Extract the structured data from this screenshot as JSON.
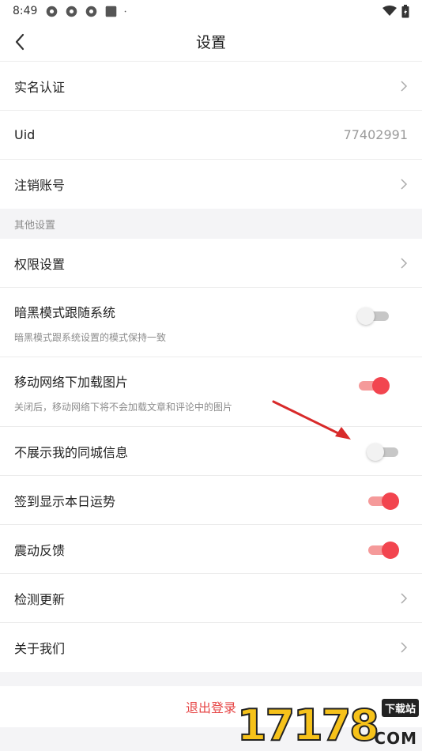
{
  "status_bar": {
    "time": "8:49"
  },
  "header": {
    "title": "设置"
  },
  "account": {
    "realname": "实名认证",
    "uid_label": "Uid",
    "uid_value": "77402991",
    "cancel_account": "注销账号"
  },
  "other": {
    "section_title": "其他设置",
    "permissions": "权限设置",
    "dark_mode": {
      "label": "暗黑模式跟随系统",
      "desc": "暗黑模式跟系统设置的模式保持一致",
      "enabled": false
    },
    "mobile_images": {
      "label": "移动网络下加载图片",
      "desc": "关闭后，移动网络下将不会加载文章和评论中的图片",
      "enabled": true
    },
    "hide_city": {
      "label": "不展示我的同城信息",
      "enabled": false
    },
    "sign_fortune": {
      "label": "签到显示本日运势",
      "enabled": true
    },
    "vibration": {
      "label": "震动反馈",
      "enabled": true
    },
    "check_update": "检测更新",
    "about": "关于我们"
  },
  "logout": {
    "label": "退出登录"
  },
  "watermark": {
    "number": "17178",
    "badge": "下载站",
    "domain": "COM"
  },
  "colors": {
    "accent": "#f2454f",
    "accent_track": "#f59a9a",
    "logout": "#e64545",
    "arrow": "#d82a2a"
  }
}
